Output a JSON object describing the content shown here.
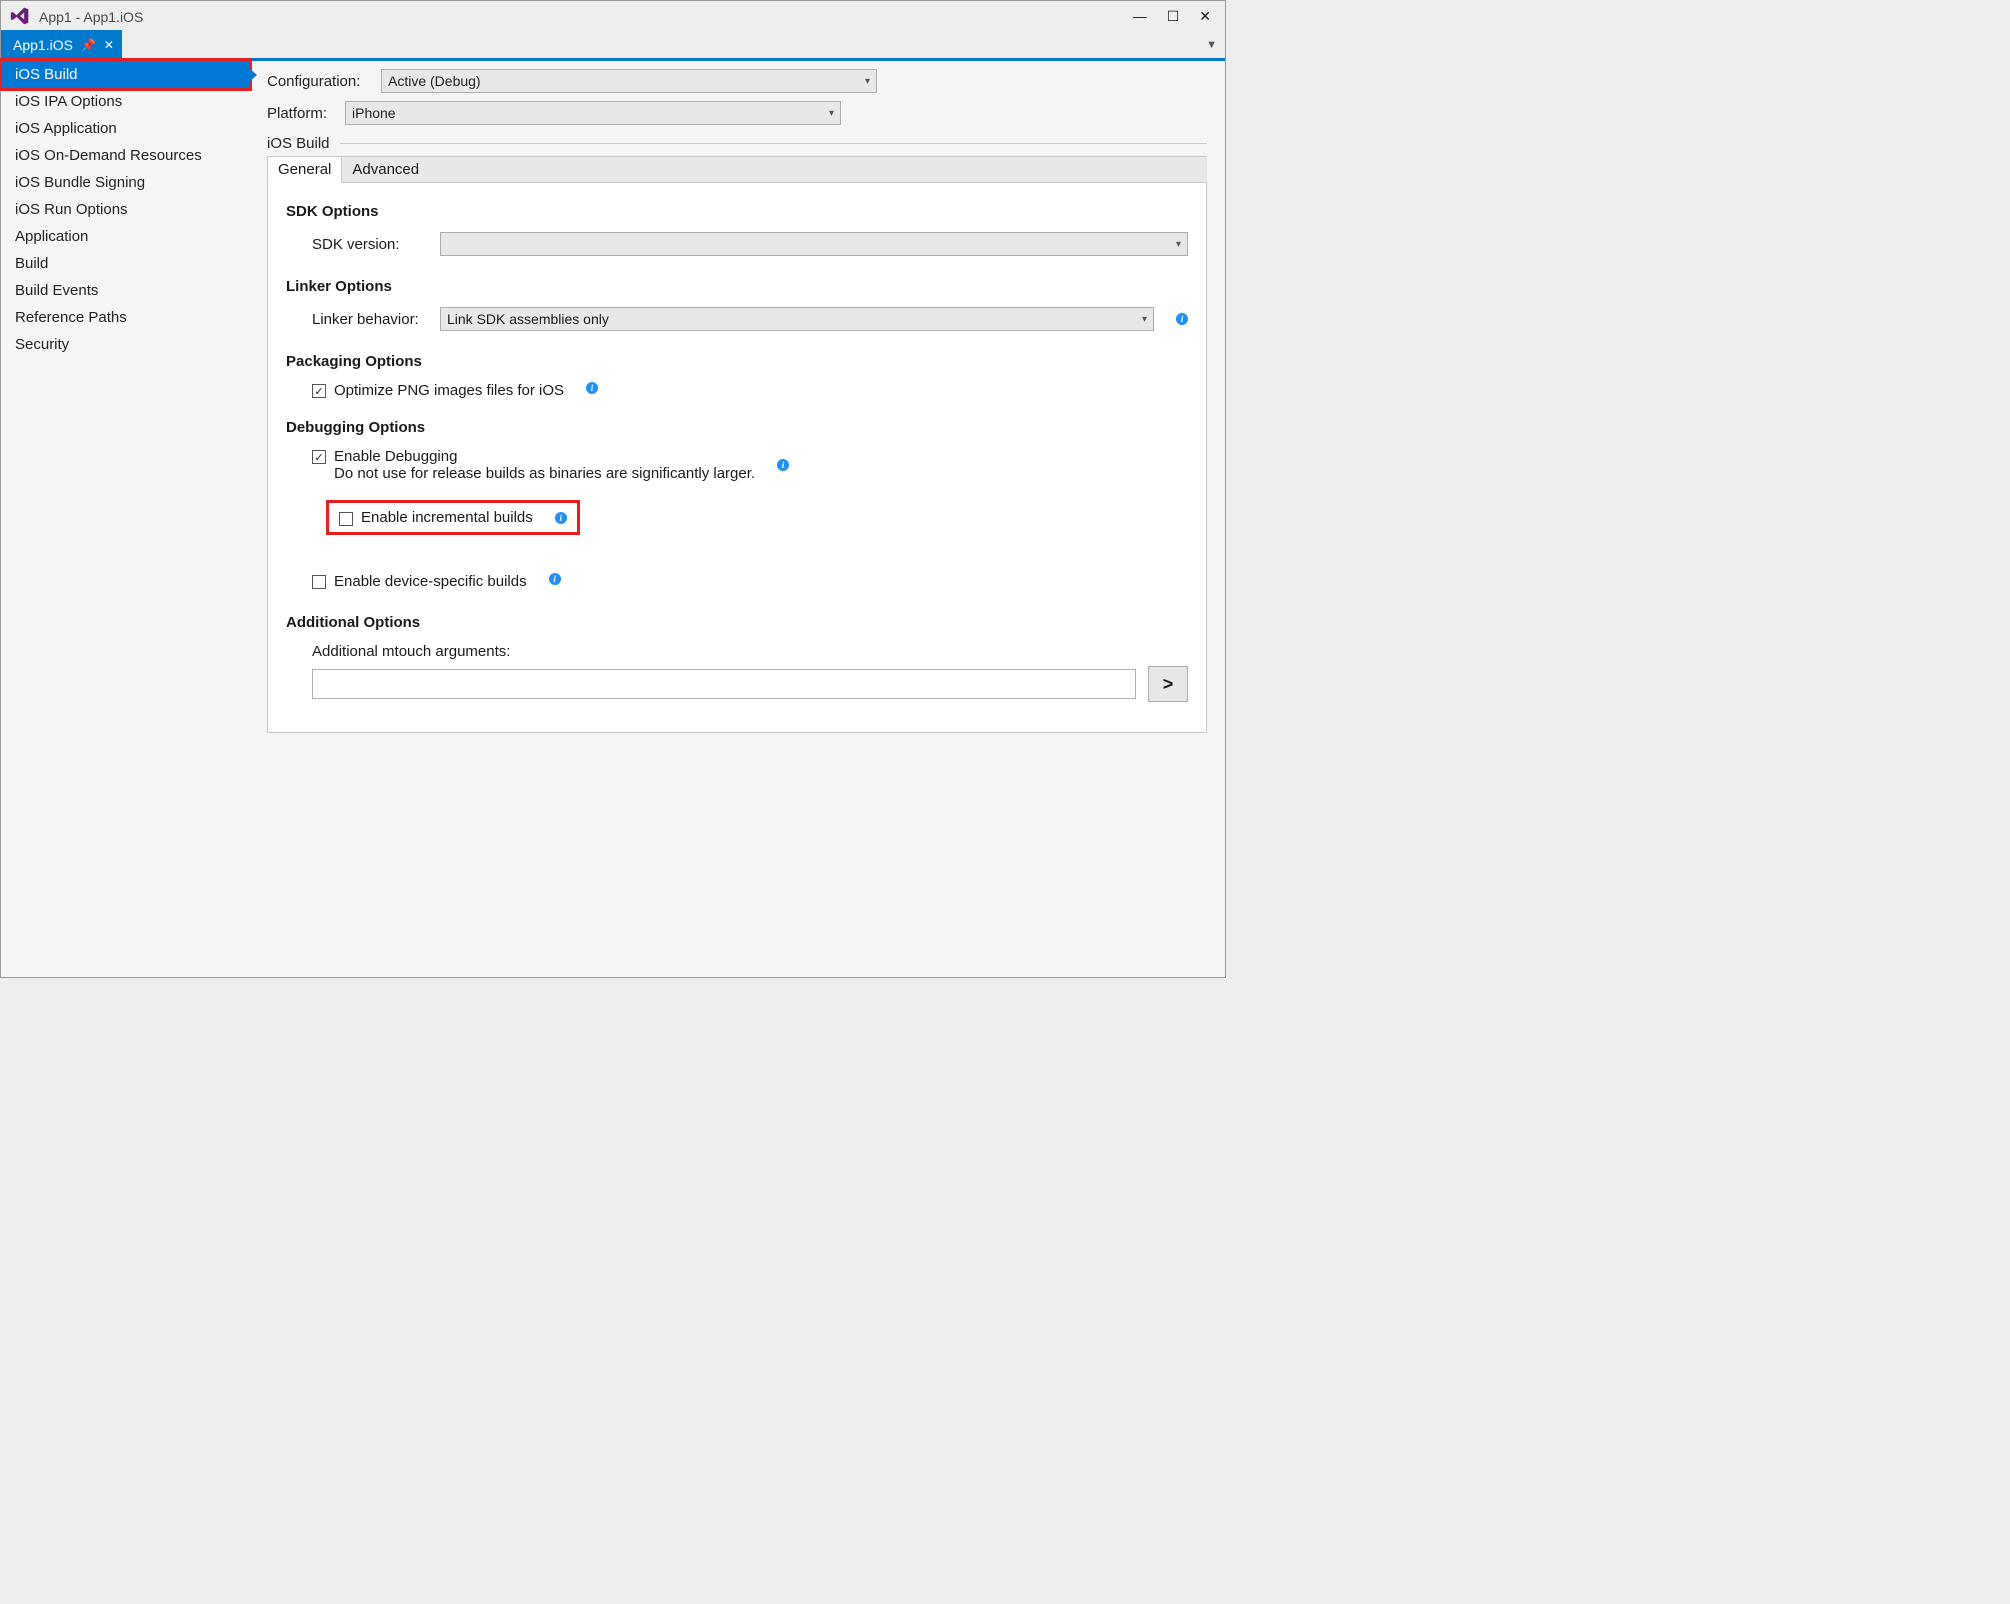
{
  "title": "App1 - App1.iOS",
  "tab": {
    "label": "App1.iOS"
  },
  "sidebar": {
    "items": [
      "iOS Build",
      "iOS IPA Options",
      "iOS Application",
      "iOS On-Demand Resources",
      "iOS Bundle Signing",
      "iOS Run Options",
      "Application",
      "Build",
      "Build Events",
      "Reference Paths",
      "Security"
    ],
    "selectedIndex": 0
  },
  "config": {
    "configurationLabel": "Configuration:",
    "configurationValue": "Active (Debug)",
    "platformLabel": "Platform:",
    "platformValue": "iPhone"
  },
  "sectionTitle": "iOS Build",
  "subtabs": {
    "general": "General",
    "advanced": "Advanced"
  },
  "sdk": {
    "title": "SDK Options",
    "versionLabel": "SDK version:",
    "versionValue": ""
  },
  "linker": {
    "title": "Linker Options",
    "behaviorLabel": "Linker behavior:",
    "behaviorValue": "Link SDK assemblies only"
  },
  "packaging": {
    "title": "Packaging Options",
    "optimizePng": "Optimize PNG images files for iOS"
  },
  "debugging": {
    "title": "Debugging Options",
    "enableDebugging": "Enable Debugging",
    "enableDebuggingNote": "Do not use for release builds as binaries are significantly larger.",
    "enableIncremental": "Enable incremental builds",
    "enableDeviceSpecific": "Enable device-specific builds"
  },
  "additional": {
    "title": "Additional Options",
    "mtouchLabel": "Additional mtouch arguments:",
    "goBtn": ">"
  }
}
